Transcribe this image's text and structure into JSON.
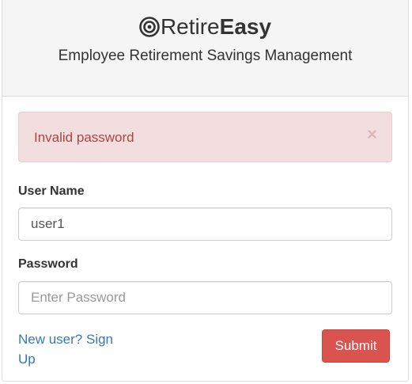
{
  "brand": {
    "name_regular": "Retire",
    "name_bold": "Easy",
    "logo_icon": "bullseye-icon",
    "subtitle": "Employee Retirement Savings Management"
  },
  "alert": {
    "message": "Invalid password",
    "close_symbol": "×",
    "background_color": "#f2dede",
    "text_color": "#a94442"
  },
  "form": {
    "username_label": "User Name",
    "username_value": "user1",
    "password_label": "Password",
    "password_placeholder": "Enter Password",
    "signup_link": "New user? Sign Up",
    "submit_label": "Submit",
    "submit_color": "#d9534f",
    "link_color": "#337ab7"
  }
}
